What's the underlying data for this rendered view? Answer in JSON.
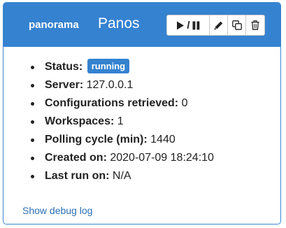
{
  "header": {
    "poller_type": "panorama",
    "poller_name": "Panos",
    "toggle_slash": "/",
    "icons": {
      "play": "play-icon",
      "pause": "pause-icon",
      "edit": "pencil-icon",
      "copy": "copy-icon",
      "delete": "trash-icon"
    }
  },
  "details": {
    "status_label": "Status:",
    "status_value": "running",
    "server_label": "Server:",
    "server_value": "127.0.0.1",
    "configs_label": "Configurations retrieved:",
    "configs_value": "0",
    "workspaces_label": "Workspaces:",
    "workspaces_value": "1",
    "polling_label": "Polling cycle (min):",
    "polling_value": "1440",
    "created_label": "Created on:",
    "created_value": "2020-07-09 18:24:10",
    "lastrun_label": "Last run on:",
    "lastrun_value": "N/A"
  },
  "footer": {
    "debug_link": "Show debug log"
  },
  "colors": {
    "header_bg": "#3582d0",
    "badge_bg": "#3582d0",
    "link": "#2a6fb7"
  }
}
